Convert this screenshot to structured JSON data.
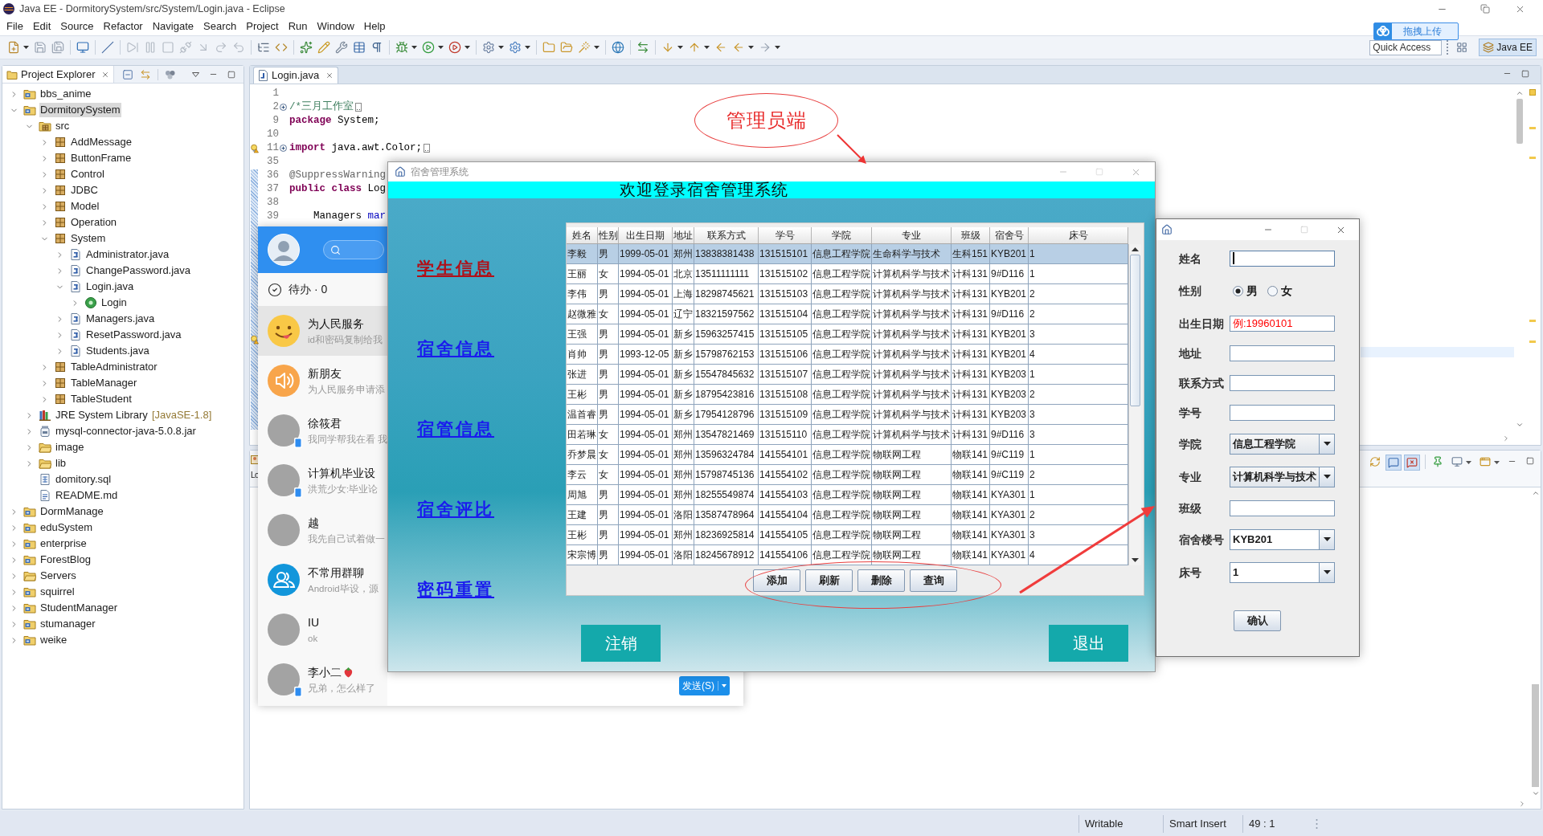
{
  "window": {
    "title": "Java EE - DormitorySystem/src/System/Login.java - Eclipse"
  },
  "menu": [
    "File",
    "Edit",
    "Source",
    "Refactor",
    "Navigate",
    "Search",
    "Project",
    "Run",
    "Window",
    "Help"
  ],
  "toolbar": {
    "quick_access": {
      "placeholder": "Quick Access"
    },
    "perspective": {
      "label": "Java EE",
      "selected": true
    }
  },
  "upload_widget": {
    "label": "拖拽上传"
  },
  "project_explorer": {
    "title": "Project Explorer",
    "tree": [
      {
        "label": "bbs_anime",
        "kind": "project",
        "expanded": false,
        "selected": false
      },
      {
        "label": "DormitorySystem",
        "kind": "project",
        "expanded": true,
        "selected": true,
        "children": [
          {
            "label": "src",
            "kind": "source",
            "expanded": true,
            "selected": false,
            "children": [
              {
                "label": "AddMessage",
                "kind": "package",
                "expanded": false,
                "selected": false
              },
              {
                "label": "ButtonFrame",
                "kind": "package",
                "expanded": false,
                "selected": false
              },
              {
                "label": "Control",
                "kind": "package",
                "expanded": false,
                "selected": false
              },
              {
                "label": "JDBC",
                "kind": "package",
                "expanded": false,
                "selected": false
              },
              {
                "label": "Model",
                "kind": "package",
                "expanded": false,
                "selected": false
              },
              {
                "label": "Operation",
                "kind": "package",
                "expanded": false,
                "selected": false
              },
              {
                "label": "System",
                "kind": "package",
                "expanded": true,
                "selected": false,
                "children": [
                  {
                    "label": "Administrator.java",
                    "kind": "java",
                    "expanded": false,
                    "selected": false
                  },
                  {
                    "label": "ChangePassword.java",
                    "kind": "java",
                    "expanded": false,
                    "selected": false
                  },
                  {
                    "label": "Login.java",
                    "kind": "java",
                    "expanded": true,
                    "selected": false,
                    "children": [
                      {
                        "label": "Login",
                        "kind": "class",
                        "expanded": false,
                        "selected": false
                      }
                    ]
                  },
                  {
                    "label": "Managers.java",
                    "kind": "java",
                    "expanded": false,
                    "selected": false
                  },
                  {
                    "label": "ResetPassword.java",
                    "kind": "java",
                    "expanded": false,
                    "selected": false
                  },
                  {
                    "label": "Students.java",
                    "kind": "java",
                    "expanded": false,
                    "selected": false
                  }
                ]
              },
              {
                "label": "TableAdministrator",
                "kind": "package",
                "expanded": false,
                "selected": false
              },
              {
                "label": "TableManager",
                "kind": "package",
                "expanded": false,
                "selected": false
              },
              {
                "label": "TableStudent",
                "kind": "package",
                "expanded": false,
                "selected": false
              }
            ]
          },
          {
            "label": "JRE System Library",
            "decoration": "[JavaSE-1.8]",
            "kind": "library",
            "expanded": false,
            "selected": false
          },
          {
            "label": "mysql-connector-java-5.0.8.jar",
            "kind": "jar",
            "expanded": false,
            "selected": false
          },
          {
            "label": "image",
            "kind": "folder",
            "expanded": false,
            "selected": false
          },
          {
            "label": "lib",
            "kind": "folder",
            "expanded": false,
            "selected": false
          },
          {
            "label": "domitory.sql",
            "kind": "sql",
            "selected": false
          },
          {
            "label": "README.md",
            "kind": "document",
            "selected": false
          }
        ]
      },
      {
        "label": "DormManage",
        "kind": "project",
        "expanded": false,
        "selected": false
      },
      {
        "label": "eduSystem",
        "kind": "project",
        "expanded": false,
        "selected": false
      },
      {
        "label": "enterprise",
        "kind": "project",
        "expanded": false,
        "selected": false
      },
      {
        "label": "ForestBlog",
        "kind": "project",
        "expanded": false,
        "selected": false
      },
      {
        "label": "Servers",
        "kind": "folder",
        "expanded": false,
        "selected": false
      },
      {
        "label": "squirrel",
        "kind": "project",
        "expanded": false,
        "selected": false
      },
      {
        "label": "StudentManager",
        "kind": "project",
        "expanded": false,
        "selected": false
      },
      {
        "label": "stumanager",
        "kind": "project",
        "expanded": false,
        "selected": false
      },
      {
        "label": "weike",
        "kind": "project",
        "expanded": false,
        "selected": false
      }
    ]
  },
  "editor": {
    "tab": {
      "label": "Login.java",
      "selected": true
    },
    "lines": [
      {
        "number": "1",
        "warning": false
      },
      {
        "number": "2",
        "warning": false,
        "collapsed": true,
        "tokens": [
          {
            "kind": "comment",
            "text": "/*三月工作室"
          }
        ]
      },
      {
        "number": "9",
        "warning": false,
        "tokens": [
          {
            "kind": "keyword",
            "text": "package"
          },
          {
            "kind": "plain",
            "text": " System;"
          }
        ]
      },
      {
        "number": "10",
        "warning": false
      },
      {
        "number": "11",
        "warning": true,
        "collapsed": true,
        "tokens": [
          {
            "kind": "keyword",
            "text": "import"
          },
          {
            "kind": "plain",
            "text": " java.awt.Color;"
          }
        ]
      },
      {
        "number": "35",
        "warning": false
      },
      {
        "number": "36",
        "warning": false,
        "tokens": [
          {
            "kind": "annotation",
            "text": "@SuppressWarning"
          }
        ]
      },
      {
        "number": "37",
        "warning": false,
        "tokens": [
          {
            "kind": "keyword",
            "text": "public class"
          },
          {
            "kind": "plain",
            "text": " Log"
          }
        ]
      },
      {
        "number": "38",
        "warning": false
      },
      {
        "number": "39",
        "warning": false,
        "tokens": [
          {
            "kind": "plain",
            "text": "    Managers "
          },
          {
            "kind": "field",
            "text": "mar"
          }
        ]
      },
      {
        "warning": false
      },
      {
        "warning": false
      },
      {
        "warning": false
      },
      {
        "warning": false
      },
      {
        "warning": false
      },
      {
        "warning": false
      },
      {
        "warning": false
      },
      {
        "warning": false
      },
      {
        "warning": true
      }
    ]
  },
  "lower_view": {
    "tab": "Lo"
  },
  "status_bar": [
    "Writable",
    "Smart Insert",
    "49 : 1"
  ],
  "chat": {
    "todo": "待办 · 0",
    "conversations": [
      {
        "name": "为人民服务",
        "message": "id和密码复制给我",
        "kind": "emoji",
        "selected": true,
        "mobile": false,
        "emoji": false
      },
      {
        "name": "新朋友",
        "message": "为人民服务申请添",
        "kind": "speaker",
        "selected": false,
        "mobile": false,
        "emoji": false
      },
      {
        "name": "徐筱君",
        "message": "我同学帮我在看 我",
        "kind": "photo",
        "selected": false,
        "mobile": true,
        "emoji": false
      },
      {
        "name": "计算机毕业设",
        "message": "洪荒少女:毕业论",
        "kind": "photo",
        "selected": false,
        "mobile": true,
        "emoji": false
      },
      {
        "name": "越",
        "message": "我先自己试着做一",
        "kind": "photo",
        "selected": false,
        "mobile": false,
        "emoji": false
      },
      {
        "name": "不常用群聊",
        "message": "Android毕设，源",
        "kind": "group",
        "selected": false,
        "mobile": false,
        "emoji": false
      },
      {
        "name": "IU",
        "message": "ok",
        "kind": "photo",
        "selected": false,
        "mobile": false,
        "emoji": false
      },
      {
        "name": "李小二",
        "message": "兄弟，怎么样了",
        "kind": "photo",
        "selected": false,
        "mobile": true,
        "emoji": true
      }
    ],
    "send_button": "发送(S)"
  },
  "dorm_window": {
    "title": "宿舍管理系统",
    "header": "欢迎登录宿舍管理系统",
    "nav": [
      {
        "label": "学生信息",
        "selected": true
      },
      {
        "label": "宿舍信息",
        "selected": false
      },
      {
        "label": "宿管信息",
        "selected": false
      },
      {
        "label": "宿舍评比",
        "selected": false
      },
      {
        "label": "密码重置",
        "selected": false
      }
    ],
    "table": {
      "columns": [
        "姓名",
        "性别",
        "出生日期",
        "地址",
        "联系方式",
        "学号",
        "学院",
        "专业",
        "班级",
        "宿舍号",
        "床号"
      ],
      "rows": [
        {
          "selected": true,
          "cells": [
            "李毅",
            "男",
            "1999-05-01",
            "郑州",
            "13838381438",
            "131515101",
            "信息工程学院",
            "生命科学与技术",
            "生科151",
            "KYB201",
            "1"
          ]
        },
        {
          "selected": false,
          "cells": [
            "王丽",
            "女",
            "1994-05-01",
            "北京",
            "13511111111",
            "131515102",
            "信息工程学院",
            "计算机科学与技术",
            "计科131",
            "9#D116",
            "1"
          ]
        },
        {
          "selected": false,
          "cells": [
            "李伟",
            "男",
            "1994-05-01",
            "上海",
            "18298745621",
            "131515103",
            "信息工程学院",
            "计算机科学与技术",
            "计科131",
            "KYB201",
            "2"
          ]
        },
        {
          "selected": false,
          "cells": [
            "赵微雅",
            "女",
            "1994-05-01",
            "辽宁",
            "18321597562",
            "131515104",
            "信息工程学院",
            "计算机科学与技术",
            "计科131",
            "9#D116",
            "2"
          ]
        },
        {
          "selected": false,
          "cells": [
            "王强",
            "男",
            "1994-05-01",
            "新乡",
            "15963257415",
            "131515105",
            "信息工程学院",
            "计算机科学与技术",
            "计科131",
            "KYB201",
            "3"
          ]
        },
        {
          "selected": false,
          "cells": [
            "肖帅",
            "男",
            "1993-12-05",
            "新乡",
            "15798762153",
            "131515106",
            "信息工程学院",
            "计算机科学与技术",
            "计科131",
            "KYB201",
            "4"
          ]
        },
        {
          "selected": false,
          "cells": [
            "张进",
            "男",
            "1994-05-01",
            "新乡",
            "15547845632",
            "131515107",
            "信息工程学院",
            "计算机科学与技术",
            "计科131",
            "KYB203",
            "1"
          ]
        },
        {
          "selected": false,
          "cells": [
            "王彬",
            "男",
            "1994-05-01",
            "新乡",
            "18795423816",
            "131515108",
            "信息工程学院",
            "计算机科学与技术",
            "计科131",
            "KYB203",
            "2"
          ]
        },
        {
          "selected": false,
          "cells": [
            "温首睿",
            "男",
            "1994-05-01",
            "新乡",
            "17954128796",
            "131515109",
            "信息工程学院",
            "计算机科学与技术",
            "计科131",
            "KYB203",
            "3"
          ]
        },
        {
          "selected": false,
          "cells": [
            "田若琳",
            "女",
            "1994-05-01",
            "郑州",
            "13547821469",
            "131515110",
            "信息工程学院",
            "计算机科学与技术",
            "计科131",
            "9#D116",
            "3"
          ]
        },
        {
          "selected": false,
          "cells": [
            "乔梦晨",
            "女",
            "1994-05-01",
            "郑州",
            "13596324784",
            "141554101",
            "信息工程学院",
            "物联网工程",
            "物联141",
            "9#C119",
            "1"
          ]
        },
        {
          "selected": false,
          "cells": [
            "李云",
            "女",
            "1994-05-01",
            "郑州",
            "15798745136",
            "141554102",
            "信息工程学院",
            "物联网工程",
            "物联141",
            "9#C119",
            "2"
          ]
        },
        {
          "selected": false,
          "cells": [
            "周旭",
            "男",
            "1994-05-01",
            "郑州",
            "18255549874",
            "141554103",
            "信息工程学院",
            "物联网工程",
            "物联141",
            "KYA301",
            "1"
          ]
        },
        {
          "selected": false,
          "cells": [
            "王建",
            "男",
            "1994-05-01",
            "洛阳",
            "13587478964",
            "141554104",
            "信息工程学院",
            "物联网工程",
            "物联141",
            "KYA301",
            "2"
          ]
        },
        {
          "selected": false,
          "cells": [
            "王彬",
            "男",
            "1994-05-01",
            "郑州",
            "18236925814",
            "141554105",
            "信息工程学院",
            "物联网工程",
            "物联141",
            "KYA301",
            "3"
          ]
        },
        {
          "selected": false,
          "cells": [
            "宋宗博",
            "男",
            "1994-05-01",
            "洛阳",
            "18245678912",
            "141554106",
            "信息工程学院",
            "物联网工程",
            "物联141",
            "KYA301",
            "4"
          ]
        }
      ]
    },
    "actions": [
      "添加",
      "刷新",
      "删除",
      "查询"
    ],
    "footer_buttons": [
      "注销",
      "退出"
    ]
  },
  "add_dialog": {
    "fields": [
      {
        "label": "姓名",
        "kind": "text",
        "focused": true
      },
      {
        "label": "性别",
        "kind": "radio",
        "options": [
          {
            "label": "男",
            "selected": true
          },
          {
            "label": "女",
            "selected": false
          }
        ]
      },
      {
        "label": "出生日期",
        "kind": "text",
        "placeholder": "例:19960101",
        "focused": false
      },
      {
        "label": "地址",
        "kind": "text",
        "focused": false
      },
      {
        "label": "联系方式",
        "kind": "text",
        "focused": false
      },
      {
        "label": "学号",
        "kind": "text",
        "focused": false
      },
      {
        "label": "学院",
        "kind": "select",
        "value": "信息工程学院",
        "editable": false
      },
      {
        "label": "专业",
        "kind": "select",
        "value": "计算机科学与技术",
        "editable": false
      },
      {
        "label": "班级",
        "kind": "text",
        "focused": false
      },
      {
        "label": "宿舍楼号",
        "kind": "select",
        "value": "KYB201",
        "editable": true
      },
      {
        "label": "床号",
        "kind": "select",
        "value": "1",
        "editable": true
      }
    ],
    "submit": "确认"
  },
  "annotation": {
    "label": "管理员端"
  }
}
